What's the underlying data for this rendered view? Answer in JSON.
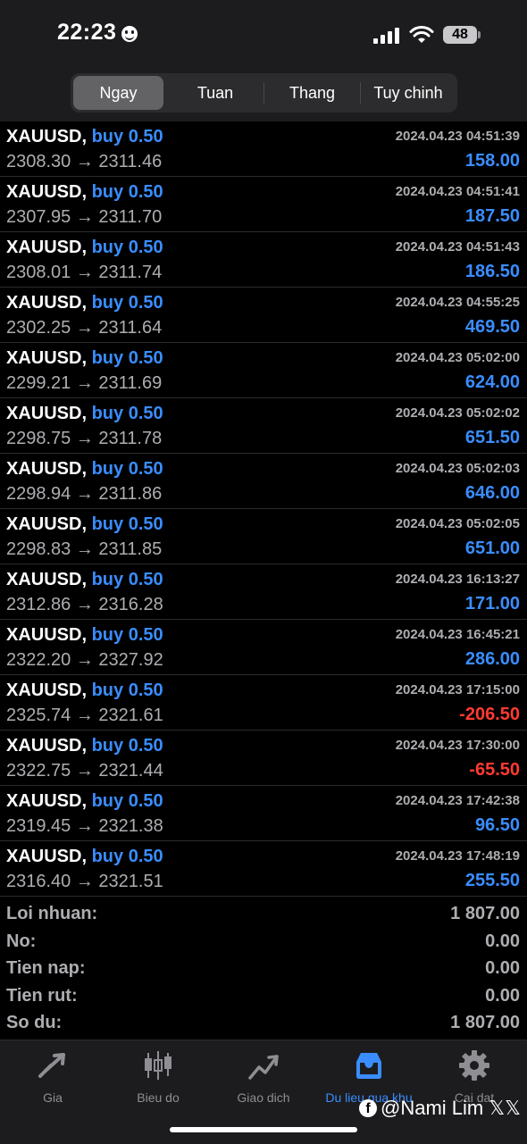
{
  "status": {
    "time": "22:23",
    "battery": "48"
  },
  "tabs_top": [
    "Ngay",
    "Tuan",
    "Thang",
    "Tuy chinh"
  ],
  "deals": [
    {
      "symbol": "XAUUSD,",
      "side": "buy 0.50",
      "date": "2024.04.23 04:51:39",
      "open": "2308.30",
      "close": "2311.46",
      "profit": "158.00",
      "negative": false
    },
    {
      "symbol": "XAUUSD,",
      "side": "buy 0.50",
      "date": "2024.04.23 04:51:41",
      "open": "2307.95",
      "close": "2311.70",
      "profit": "187.50",
      "negative": false
    },
    {
      "symbol": "XAUUSD,",
      "side": "buy 0.50",
      "date": "2024.04.23 04:51:43",
      "open": "2308.01",
      "close": "2311.74",
      "profit": "186.50",
      "negative": false
    },
    {
      "symbol": "XAUUSD,",
      "side": "buy 0.50",
      "date": "2024.04.23 04:55:25",
      "open": "2302.25",
      "close": "2311.64",
      "profit": "469.50",
      "negative": false
    },
    {
      "symbol": "XAUUSD,",
      "side": "buy 0.50",
      "date": "2024.04.23 05:02:00",
      "open": "2299.21",
      "close": "2311.69",
      "profit": "624.00",
      "negative": false
    },
    {
      "symbol": "XAUUSD,",
      "side": "buy 0.50",
      "date": "2024.04.23 05:02:02",
      "open": "2298.75",
      "close": "2311.78",
      "profit": "651.50",
      "negative": false
    },
    {
      "symbol": "XAUUSD,",
      "side": "buy 0.50",
      "date": "2024.04.23 05:02:03",
      "open": "2298.94",
      "close": "2311.86",
      "profit": "646.00",
      "negative": false
    },
    {
      "symbol": "XAUUSD,",
      "side": "buy 0.50",
      "date": "2024.04.23 05:02:05",
      "open": "2298.83",
      "close": "2311.85",
      "profit": "651.00",
      "negative": false
    },
    {
      "symbol": "XAUUSD,",
      "side": "buy 0.50",
      "date": "2024.04.23 16:13:27",
      "open": "2312.86",
      "close": "2316.28",
      "profit": "171.00",
      "negative": false
    },
    {
      "symbol": "XAUUSD,",
      "side": "buy 0.50",
      "date": "2024.04.23 16:45:21",
      "open": "2322.20",
      "close": "2327.92",
      "profit": "286.00",
      "negative": false
    },
    {
      "symbol": "XAUUSD,",
      "side": "buy 0.50",
      "date": "2024.04.23 17:15:00",
      "open": "2325.74",
      "close": "2321.61",
      "profit": "-206.50",
      "negative": true
    },
    {
      "symbol": "XAUUSD,",
      "side": "buy 0.50",
      "date": "2024.04.23 17:30:00",
      "open": "2322.75",
      "close": "2321.44",
      "profit": "-65.50",
      "negative": true
    },
    {
      "symbol": "XAUUSD,",
      "side": "buy 0.50",
      "date": "2024.04.23 17:42:38",
      "open": "2319.45",
      "close": "2321.38",
      "profit": "96.50",
      "negative": false
    },
    {
      "symbol": "XAUUSD,",
      "side": "buy 0.50",
      "date": "2024.04.23 17:48:19",
      "open": "2316.40",
      "close": "2321.51",
      "profit": "255.50",
      "negative": false
    }
  ],
  "arrow": "→",
  "summary": [
    {
      "label": "Loi nhuan:",
      "value": "1 807.00"
    },
    {
      "label": "No:",
      "value": "0.00"
    },
    {
      "label": "Tien nap:",
      "value": "0.00"
    },
    {
      "label": "Tien rut:",
      "value": "0.00"
    },
    {
      "label": "So du:",
      "value": "1 807.00"
    }
  ],
  "tabbar": [
    {
      "label": "Gia",
      "icon": "price-arrows-icon"
    },
    {
      "label": "Bieu do",
      "icon": "candlestick-chart-icon"
    },
    {
      "label": "Giao dich",
      "icon": "trade-chart-icon"
    },
    {
      "label": "Du lieu qua khu",
      "icon": "history-tray-icon",
      "active": true
    },
    {
      "label": "Cai dat",
      "icon": "gear-icon"
    }
  ],
  "watermark": "@Nami Lim 𝕏𝕏",
  "colors": {
    "accent": "#3a8dff",
    "negative": "#ff3b30",
    "muted": "#aeaeb2"
  }
}
